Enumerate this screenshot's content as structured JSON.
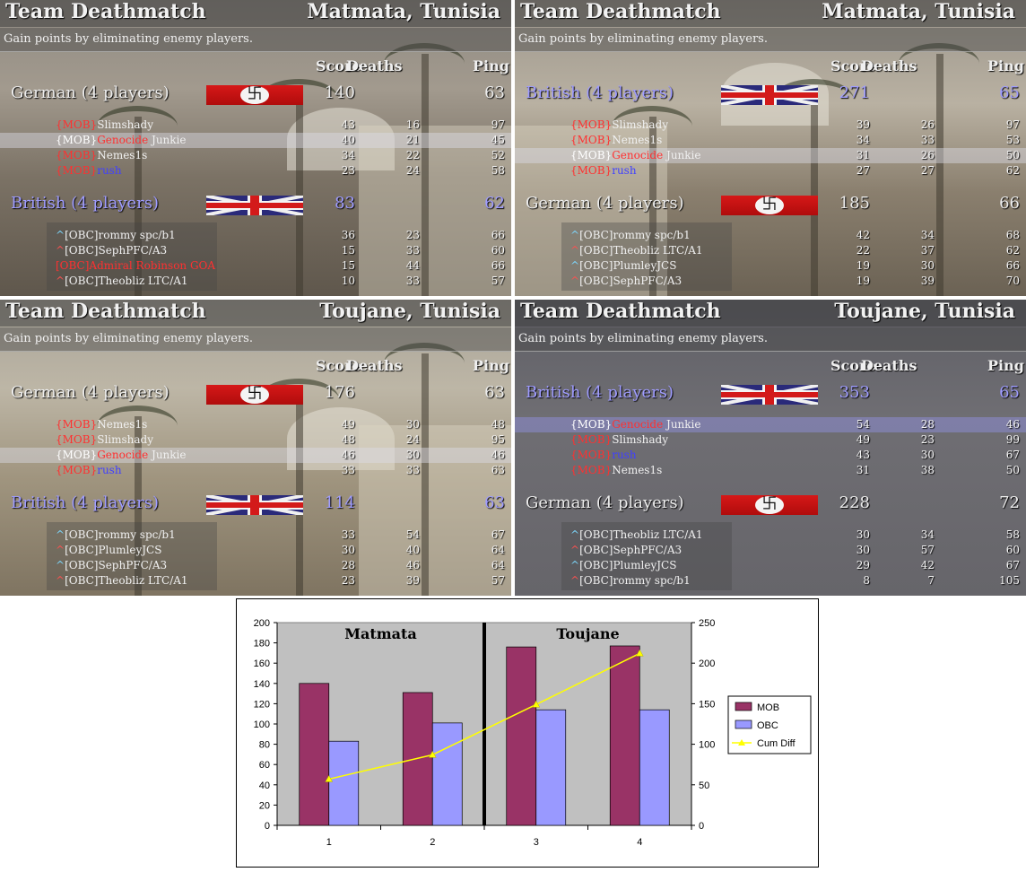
{
  "panels": [
    {
      "title": "Team Deathmatch",
      "map": "Matmata, Tunisia",
      "subtitle": "Gain points by eliminating enemy players.",
      "columns": {
        "score": "Score",
        "deaths": "Deaths",
        "ping": "Ping"
      },
      "teams": [
        {
          "name": "German (4 players)",
          "side": "german",
          "score": "140",
          "ping": "63",
          "players": [
            {
              "tag": "{MOB}",
              "name": "Slimshady",
              "score": "43",
              "deaths": "16",
              "ping": "97"
            },
            {
              "tag": "{MOB}",
              "name": "Genocide",
              "name2": " Junkie",
              "score": "40",
              "deaths": "21",
              "ping": "45",
              "highlight": true
            },
            {
              "tag": "{MOB}",
              "name": "Nemes1s",
              "score": "34",
              "deaths": "22",
              "ping": "52"
            },
            {
              "tag": "{MOB}",
              "name": "rush",
              "score": "23",
              "deaths": "24",
              "ping": "58"
            }
          ]
        },
        {
          "name": "British (4 players)",
          "side": "british",
          "score": "83",
          "ping": "62",
          "players": [
            {
              "tag": "^",
              "name": "[OBC]rommy spc/b1",
              "score": "36",
              "deaths": "23",
              "ping": "66"
            },
            {
              "tag": "^",
              "name": "[OBC]SephPFC/A3",
              "score": "15",
              "deaths": "33",
              "ping": "60"
            },
            {
              "tag": "",
              "name": "[OBC]Admiral Robinson GOA",
              "score": "15",
              "deaths": "44",
              "ping": "66"
            },
            {
              "tag": "^",
              "name": "[OBC]Theobliz LTC/A1",
              "score": "10",
              "deaths": "33",
              "ping": "57"
            }
          ]
        }
      ]
    },
    {
      "title": "Team Deathmatch",
      "map": "Matmata, Tunisia",
      "subtitle": "Gain points by eliminating enemy players.",
      "columns": {
        "score": "Score",
        "deaths": "Deaths",
        "ping": "Ping"
      },
      "teams": [
        {
          "name": "British (4 players)",
          "side": "british",
          "score": "271",
          "ping": "65",
          "players": [
            {
              "tag": "{MOB}",
              "name": "Slimshady",
              "score": "39",
              "deaths": "26",
              "ping": "97"
            },
            {
              "tag": "{MOB}",
              "name": "Nemes1s",
              "score": "34",
              "deaths": "33",
              "ping": "53"
            },
            {
              "tag": "{MOB}",
              "name": "Genocide",
              "name2": " Junkie",
              "score": "31",
              "deaths": "26",
              "ping": "50",
              "highlight": true
            },
            {
              "tag": "{MOB}",
              "name": "rush",
              "score": "27",
              "deaths": "27",
              "ping": "62"
            }
          ]
        },
        {
          "name": "German (4 players)",
          "side": "german",
          "score": "185",
          "ping": "66",
          "players": [
            {
              "tag": "^",
              "name": "[OBC]rommy spc/b1",
              "score": "42",
              "deaths": "34",
              "ping": "68"
            },
            {
              "tag": "^",
              "name": "[OBC]Theobliz LTC/A1",
              "score": "22",
              "deaths": "37",
              "ping": "62"
            },
            {
              "tag": "^",
              "name": "[OBC]PlumleyJCS",
              "score": "19",
              "deaths": "30",
              "ping": "66"
            },
            {
              "tag": "^",
              "name": "[OBC]SephPFC/A3",
              "score": "19",
              "deaths": "39",
              "ping": "70"
            }
          ]
        }
      ]
    },
    {
      "title": "Team Deathmatch",
      "map": "Toujane, Tunisia",
      "subtitle": "Gain points by eliminating enemy players.",
      "columns": {
        "score": "Score",
        "deaths": "Deaths",
        "ping": "Ping"
      },
      "teams": [
        {
          "name": "German (4 players)",
          "side": "german",
          "score": "176",
          "ping": "63",
          "players": [
            {
              "tag": "{MOB}",
              "name": "Nemes1s",
              "score": "49",
              "deaths": "30",
              "ping": "48"
            },
            {
              "tag": "{MOB}",
              "name": "Slimshady",
              "score": "48",
              "deaths": "24",
              "ping": "95"
            },
            {
              "tag": "{MOB}",
              "name": "Genocide",
              "name2": " Junkie",
              "score": "46",
              "deaths": "30",
              "ping": "46",
              "highlight": true
            },
            {
              "tag": "{MOB}",
              "name": "rush",
              "score": "33",
              "deaths": "33",
              "ping": "63"
            }
          ]
        },
        {
          "name": "British (4 players)",
          "side": "british",
          "score": "114",
          "ping": "63",
          "players": [
            {
              "tag": "^",
              "name": "[OBC]rommy spc/b1",
              "score": "33",
              "deaths": "54",
              "ping": "67"
            },
            {
              "tag": "^",
              "name": "[OBC]PlumleyJCS",
              "score": "30",
              "deaths": "40",
              "ping": "64"
            },
            {
              "tag": "^",
              "name": "[OBC]SephPFC/A3",
              "score": "28",
              "deaths": "46",
              "ping": "64"
            },
            {
              "tag": "^",
              "name": "[OBC]Theobliz LTC/A1",
              "score": "23",
              "deaths": "39",
              "ping": "57"
            }
          ]
        }
      ]
    },
    {
      "title": "Team Deathmatch",
      "map": "Toujane, Tunisia",
      "subtitle": "Gain points by eliminating enemy players.",
      "columns": {
        "score": "Score",
        "deaths": "Deaths",
        "ping": "Ping"
      },
      "teams": [
        {
          "name": "British (4 players)",
          "side": "british",
          "score": "353",
          "ping": "65",
          "players": [
            {
              "tag": "{MOB}",
              "name": "Genocide",
              "name2": " Junkie",
              "score": "54",
              "deaths": "28",
              "ping": "46",
              "highlight": true
            },
            {
              "tag": "{MOB}",
              "name": "Slimshady",
              "score": "49",
              "deaths": "23",
              "ping": "99"
            },
            {
              "tag": "{MOB}",
              "name": "rush",
              "score": "43",
              "deaths": "30",
              "ping": "67"
            },
            {
              "tag": "{MOB}",
              "name": "Nemes1s",
              "score": "31",
              "deaths": "38",
              "ping": "50"
            }
          ]
        },
        {
          "name": "German (4 players)",
          "side": "german",
          "score": "228",
          "ping": "72",
          "players": [
            {
              "tag": "^",
              "name": "[OBC]Theobliz LTC/A1",
              "score": "30",
              "deaths": "34",
              "ping": "58"
            },
            {
              "tag": "^",
              "name": "[OBC]SephPFC/A3",
              "score": "30",
              "deaths": "57",
              "ping": "60"
            },
            {
              "tag": "^",
              "name": "[OBC]PlumleyJCS",
              "score": "29",
              "deaths": "42",
              "ping": "67"
            },
            {
              "tag": "^",
              "name": "[OBC]rommy spc/b1",
              "score": "8",
              "deaths": "7",
              "ping": "105"
            }
          ]
        }
      ]
    }
  ],
  "chart_data": {
    "type": "bar",
    "categories": [
      "1",
      "2",
      "3",
      "4"
    ],
    "series": [
      {
        "name": "MOB",
        "type": "bar",
        "axis": "left",
        "values": [
          140,
          131,
          176,
          177
        ],
        "color": "#993366"
      },
      {
        "name": "OBC",
        "type": "bar",
        "axis": "left",
        "values": [
          83,
          101,
          114,
          114
        ],
        "color": "#9999ff"
      },
      {
        "name": "Cum Diff",
        "type": "line",
        "axis": "right",
        "values": [
          57,
          87,
          149,
          212
        ],
        "color": "#ffff00"
      }
    ],
    "ylim": [
      0,
      200
    ],
    "y2lim": [
      0,
      250
    ],
    "yticks": [
      "0",
      "20",
      "40",
      "60",
      "80",
      "100",
      "120",
      "140",
      "160",
      "180",
      "200"
    ],
    "y2ticks": [
      "0",
      "50",
      "100",
      "150",
      "200",
      "250"
    ],
    "annotations": [
      "Matmata",
      "Toujane"
    ],
    "legend": "right",
    "grid": false,
    "plot_background": "#c0c0c0"
  }
}
